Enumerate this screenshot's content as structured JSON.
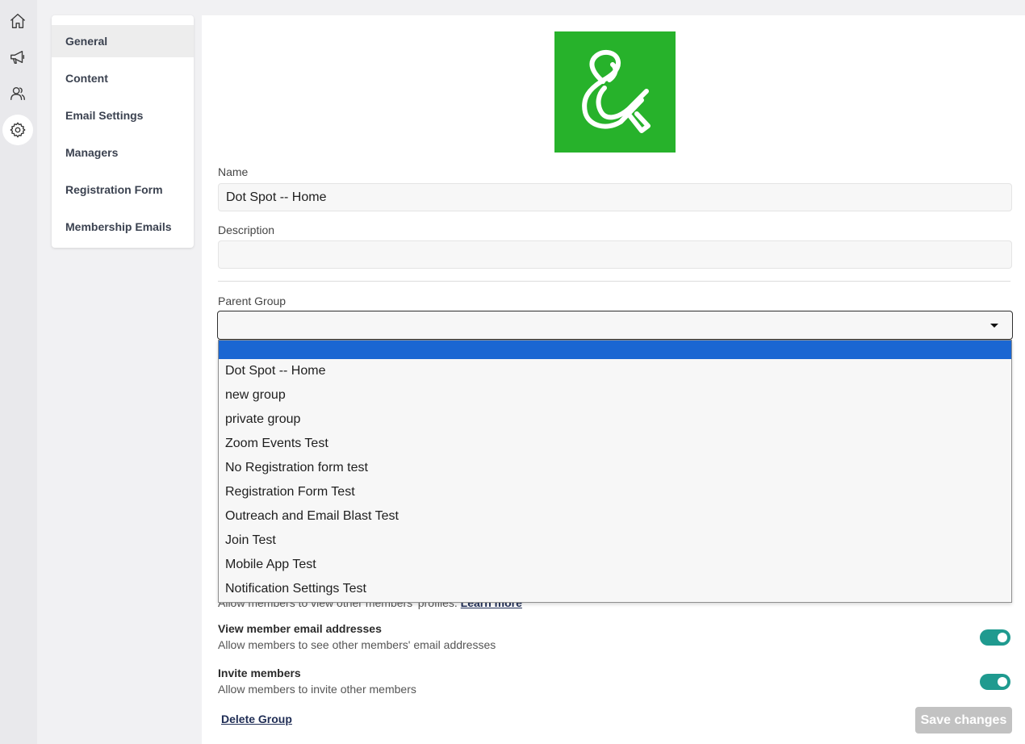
{
  "rail": {
    "items": [
      {
        "icon": "home-icon"
      },
      {
        "icon": "megaphone-icon"
      },
      {
        "icon": "users-icon"
      },
      {
        "icon": "gear-icon",
        "active": true
      }
    ]
  },
  "subnav": {
    "items": [
      {
        "label": "General",
        "active": true
      },
      {
        "label": "Content"
      },
      {
        "label": "Email Settings"
      },
      {
        "label": "Managers"
      },
      {
        "label": "Registration Form"
      },
      {
        "label": "Membership Emails"
      }
    ]
  },
  "form": {
    "logo_color": "#27b22b",
    "name_label": "Name",
    "name_value": "Dot Spot -- Home",
    "description_label": "Description",
    "description_value": "",
    "parent_group_label": "Parent Group",
    "parent_group_value": "",
    "parent_group_options": [
      "",
      "Dot Spot -- Home",
      "new group",
      "private group",
      "Zoom Events Test",
      "No Registration form test",
      "Registration Form Test",
      "Outreach and Email Blast Test",
      "Join Test",
      "Mobile App Test",
      "Notification Settings Test"
    ]
  },
  "settings": {
    "profiles_desc_partial": "Allow members to view other members' profiles.",
    "learn_more": "Learn more",
    "view_emails_title": "View member email addresses",
    "view_emails_desc": "Allow members to see other members' email addresses",
    "view_emails_on": true,
    "invite_title": "Invite members",
    "invite_desc": "Allow members to invite other members",
    "invite_on": true
  },
  "actions": {
    "delete_label": "Delete Group",
    "save_label": "Save changes"
  },
  "colors": {
    "accent": "#1f9a8f",
    "selected_option": "#1a66d2"
  }
}
